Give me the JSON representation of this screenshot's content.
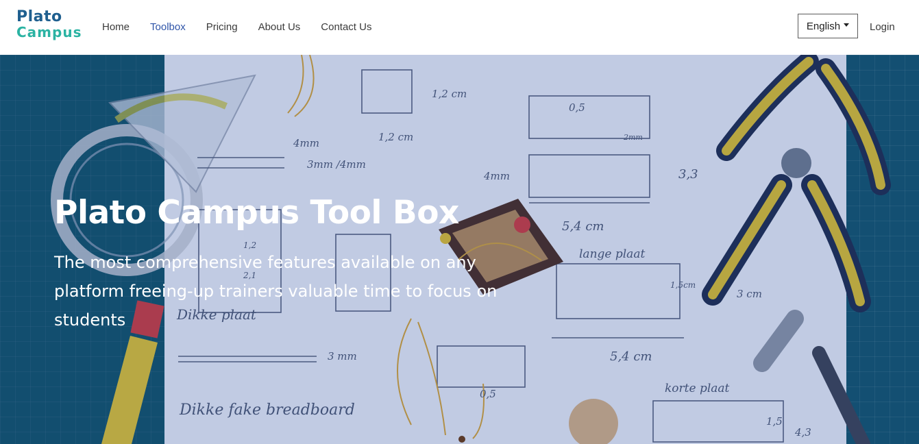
{
  "brand": {
    "logo_line1": "Plato",
    "logo_line2": "Campus",
    "color_primary": "#1f5f8f",
    "color_accent": "#2bb3a3"
  },
  "nav": {
    "items": [
      {
        "label": "Home",
        "active": false
      },
      {
        "label": "Toolbox",
        "active": true
      },
      {
        "label": "Pricing",
        "active": false
      },
      {
        "label": "About Us",
        "active": false
      },
      {
        "label": "Contact Us",
        "active": false
      }
    ],
    "active_color": "#2e54a8"
  },
  "language": {
    "selected": "English"
  },
  "auth": {
    "login_label": "Login"
  },
  "hero": {
    "title": "Plato Campus Tool Box",
    "subtitle": "The most comprehensive features available on any platform freeing-up trainers valuable time to focus on students",
    "background_image": "photo of workbench with paper sketches of a breadboard box, measurements, pliers, tape and tools"
  },
  "sketch_text": {
    "m1": "1,2 cm",
    "m2": "1,2 cm",
    "m3": "0,5",
    "m4": "2mm",
    "m5": "4mm",
    "m6": "3mm /4mm",
    "m7": "4mm",
    "m8": "3,3",
    "m9": "5,4 cm",
    "m10": "lange plaat",
    "m11": "1,5cm",
    "m12": "3 cm",
    "m13": "5,4 cm",
    "m14": "Dikke plaat",
    "m15": "3 mm",
    "m16": "Dikke fake breadboard",
    "m17": "korte plaat",
    "m18": "1,5",
    "m19": "4,3",
    "m20": "0,5",
    "m21": "2,1",
    "m22": "1,2"
  }
}
